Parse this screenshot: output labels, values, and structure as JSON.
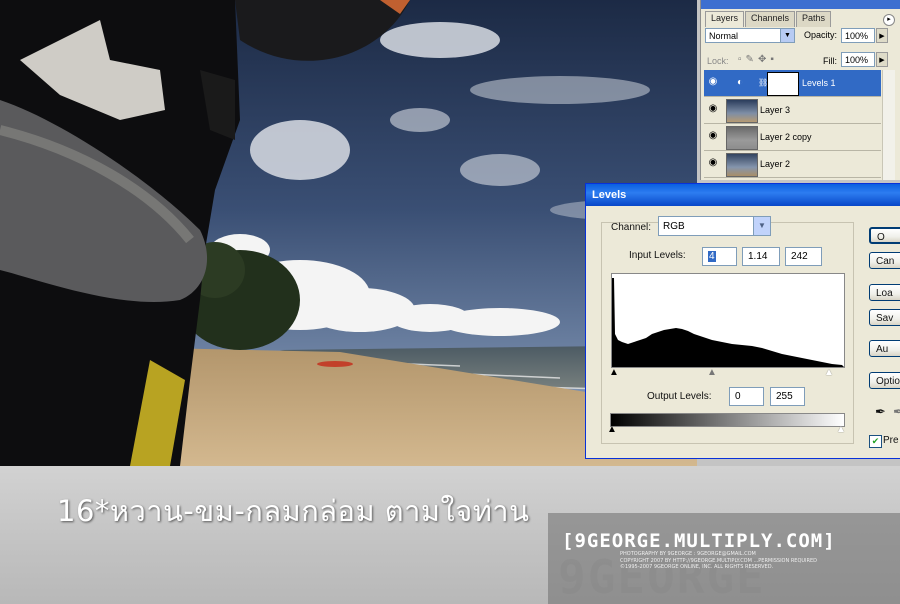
{
  "layers_panel": {
    "tabs": [
      "Layers",
      "Channels",
      "Paths"
    ],
    "blend_mode": "Normal",
    "opacity_label": "Opacity:",
    "opacity_value": "100%",
    "lock_label": "Lock:",
    "fill_label": "Fill:",
    "fill_value": "100%",
    "layers": [
      {
        "name": "Levels 1",
        "selected": true
      },
      {
        "name": "Layer 3",
        "selected": false
      },
      {
        "name": "Layer 2 copy",
        "selected": false
      },
      {
        "name": "Layer 2",
        "selected": false
      }
    ]
  },
  "levels_dialog": {
    "title": "Levels",
    "channel_label": "Channel:",
    "channel_value": "RGB",
    "input_levels_label": "Input Levels:",
    "input_black": "4",
    "input_gamma": "1.14",
    "input_white": "242",
    "output_levels_label": "Output Levels:",
    "output_black": "0",
    "output_white": "255",
    "buttons": [
      "O",
      "Can",
      "Loa",
      "Sav",
      "Au",
      "Optio"
    ],
    "preview_label": "Pre"
  },
  "caption": "16*หวาน-ขม-กลมกล่อม ตามใจท่าน",
  "watermark": {
    "title": "[9GEORGE.MULTIPLY.COM]",
    "line1": "PHOTOGRAPHY BY 9GEORGE : 9GEORGE@GMAIL.COM",
    "line2": "COPYRIGHT 2007 BY HTTP://9GEORGE.MULTIPLY.COM ...PERMISSION REQUIRED",
    "line3": "©1995-2007 9GEORGE ONLINE, INC. ALL RIGHTS RESERVED.",
    "ghost": "9GEORGE"
  },
  "icons": {
    "eye": "eye-icon",
    "dropdown": "chevron-down-icon",
    "eyedropper": "eyedropper-icon"
  }
}
